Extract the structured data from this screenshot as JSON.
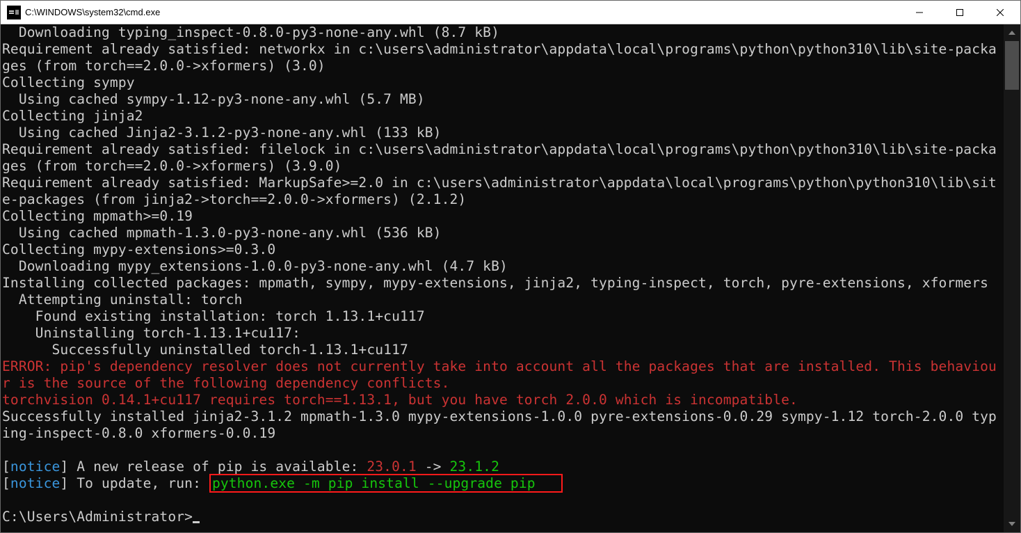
{
  "window": {
    "title": "C:\\WINDOWS\\system32\\cmd.exe"
  },
  "terminal": {
    "lines": {
      "l0": "  Downloading typing_inspect-0.8.0-py3-none-any.whl (8.7 kB)",
      "l1": "Requirement already satisfied: networkx in c:\\users\\administrator\\appdata\\local\\programs\\python\\python310\\lib\\site-packages (from torch==2.0.0->xformers) (3.0)",
      "l2": "Collecting sympy",
      "l3": "  Using cached sympy-1.12-py3-none-any.whl (5.7 MB)",
      "l4": "Collecting jinja2",
      "l5": "  Using cached Jinja2-3.1.2-py3-none-any.whl (133 kB)",
      "l6": "Requirement already satisfied: filelock in c:\\users\\administrator\\appdata\\local\\programs\\python\\python310\\lib\\site-packages (from torch==2.0.0->xformers) (3.9.0)",
      "l7": "Requirement already satisfied: MarkupSafe>=2.0 in c:\\users\\administrator\\appdata\\local\\programs\\python\\python310\\lib\\site-packages (from jinja2->torch==2.0.0->xformers) (2.1.2)",
      "l8": "Collecting mpmath>=0.19",
      "l9": "  Using cached mpmath-1.3.0-py3-none-any.whl (536 kB)",
      "l10": "Collecting mypy-extensions>=0.3.0",
      "l11": "  Downloading mypy_extensions-1.0.0-py3-none-any.whl (4.7 kB)",
      "l12": "Installing collected packages: mpmath, sympy, mypy-extensions, jinja2, typing-inspect, torch, pyre-extensions, xformers",
      "l13": "  Attempting uninstall: torch",
      "l14": "    Found existing installation: torch 1.13.1+cu117",
      "l15": "    Uninstalling torch-1.13.1+cu117:",
      "l16": "      Successfully uninstalled torch-1.13.1+cu117",
      "l17": "ERROR: pip's dependency resolver does not currently take into account all the packages that are installed. This behaviour is the source of the following dependency conflicts.",
      "l18": "torchvision 0.14.1+cu117 requires torch==1.13.1, but you have torch 2.0.0 which is incompatible.",
      "l19": "Successfully installed jinja2-3.1.2 mpmath-1.3.0 mypy-extensions-1.0.0 pyre-extensions-0.0.29 sympy-1.12 torch-2.0.0 typing-inspect-0.8.0 xformers-0.0.19",
      "notice1_label": "notice",
      "notice1_text_a": " A new release of pip is available: ",
      "notice1_old": "23.0.1",
      "notice1_arrow": " -> ",
      "notice1_new": "23.1.2",
      "notice2_label": "notice",
      "notice2_text": " To update, run: ",
      "notice2_cmd": "python.exe -m pip install --upgrade pip",
      "prompt": "C:\\Users\\Administrator>"
    }
  }
}
